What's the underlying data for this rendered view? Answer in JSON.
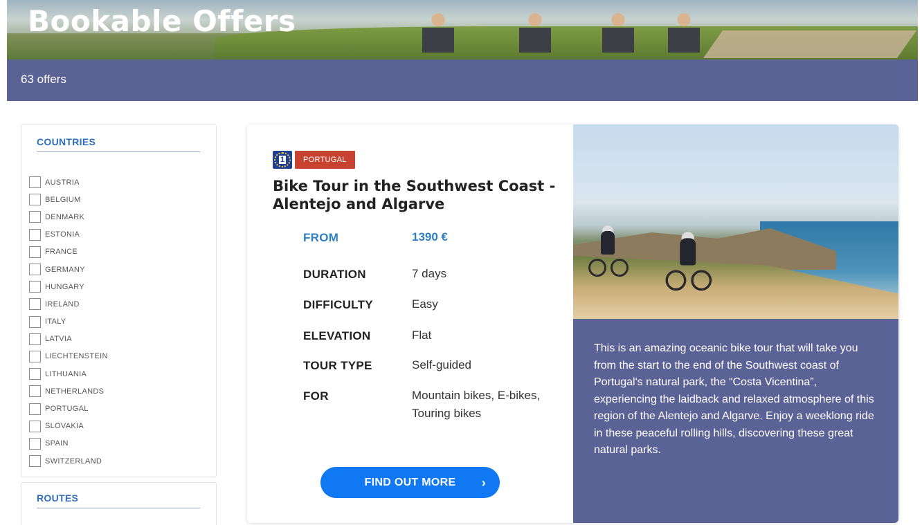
{
  "header": {
    "title": "Bookable Offers",
    "offer_count": "63 offers"
  },
  "filters": {
    "countries_title": "COUNTRIES",
    "countries": [
      "AUSTRIA",
      "BELGIUM",
      "DENMARK",
      "ESTONIA",
      "FRANCE",
      "GERMANY",
      "HUNGARY",
      "IRELAND",
      "ITALY",
      "LATVIA",
      "LIECHTENSTEIN",
      "LITHUANIA",
      "NETHERLANDS",
      "PORTUGAL",
      "SLOVAKIA",
      "SPAIN",
      "SWITZERLAND"
    ],
    "routes_title": "ROUTES"
  },
  "offer": {
    "eurovelo_number": "1",
    "country_tag": "PORTUGAL",
    "title": "Bike Tour in the Southwest Coast - Alentejo and Algarve",
    "specs": {
      "from_label": "FROM",
      "from_value": "1390 €",
      "duration_label": "DURATION",
      "duration_value": "7 days",
      "difficulty_label": "DIFFICULTY",
      "difficulty_value": "Easy",
      "elevation_label": "ELEVATION",
      "elevation_value": "Flat",
      "tour_type_label": "TOUR TYPE",
      "tour_type_value": "Self-guided",
      "for_label": "FOR",
      "for_value": "Mountain bikes, E-bikes, Touring bikes"
    },
    "cta_label": "FIND OUT MORE",
    "cta_icon": "chevron-right-icon",
    "description": "This is an amazing oceanic bike tour that will take you from the start to the end of the Southwest coast of Portugal's natural park, the “Costa Vicentina”, experiencing the laidback and relaxed atmosphere of this region of the Alentejo and Algarve. Enjoy a weeklong ride in these peaceful rolling hills, discovering these great natural parks."
  },
  "colors": {
    "brand_purple": "#5b6296",
    "accent_blue": "#0f78f2",
    "link_blue": "#2e7fc4",
    "tag_red": "#c8432f"
  }
}
